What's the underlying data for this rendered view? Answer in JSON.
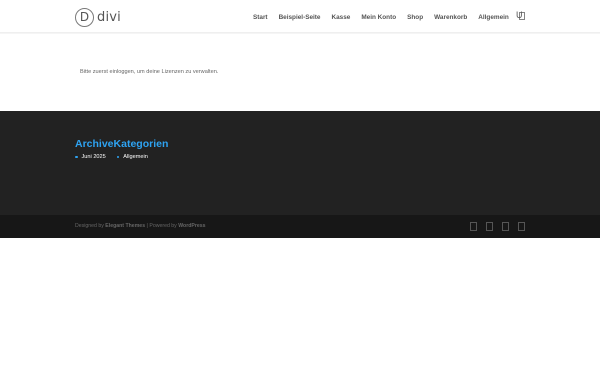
{
  "header": {
    "logo_letter": "D",
    "logo_text": "divi",
    "nav": [
      "Start",
      "Beispiel-Seite",
      "Kasse",
      "Mein Konto",
      "Shop",
      "Warenkorb",
      "Allgemein"
    ],
    "search_glyph": "U",
    "cart_icon": "cart-icon"
  },
  "main": {
    "notice": "Bitte zuerst einloggen, um deine Lizenzen zu verwalten."
  },
  "footer": {
    "widget_title": "ArchiveKategorien",
    "items": [
      "Juni 2025",
      "Allgemein"
    ],
    "accent_color": "#2ea3f2",
    "background_color": "#222222"
  },
  "bottom_bar": {
    "designed_by": "Designed by",
    "elegant_themes": "Elegant Themes",
    "separator": "|",
    "powered_by": "Powered by",
    "wordpress": "WordPress",
    "social_icons": [
      "facebook-icon",
      "twitter-icon",
      "google-plus-icon",
      "rss-icon"
    ]
  }
}
